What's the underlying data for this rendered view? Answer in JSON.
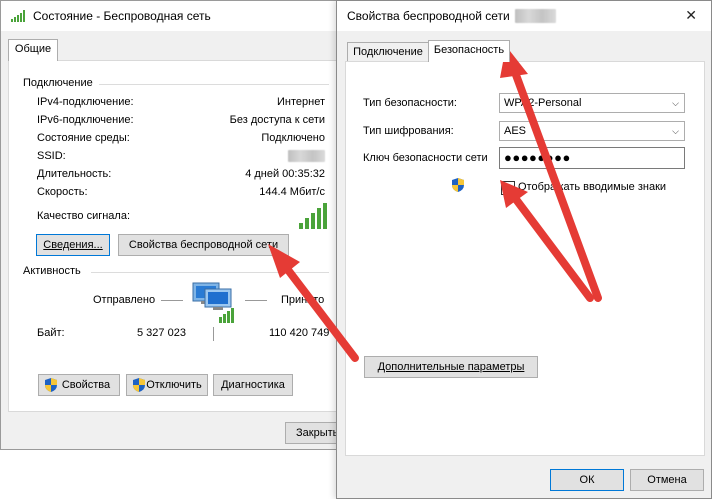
{
  "status_window": {
    "title": "Состояние - Беспроводная сеть",
    "close_glyph": "✕",
    "tab_general": "Общие",
    "section_connection": "Подключение",
    "rows": [
      {
        "label": "IPv4-подключение:",
        "value": "Интернет"
      },
      {
        "label": "IPv6-подключение:",
        "value": "Без доступа к сети"
      },
      {
        "label": "Состояние среды:",
        "value": "Подключено"
      },
      {
        "label": "SSID:",
        "value": "wifi_net"
      },
      {
        "label": "Длительность:",
        "value": "4 дней 00:35:32"
      },
      {
        "label": "Скорость:",
        "value": "144.4 Мбит/с"
      }
    ],
    "signal_quality_label": "Качество сигнала:",
    "details_button": "Сведения...",
    "wireless_props_button": "Свойства беспроводной сети",
    "section_activity": "Активность",
    "sent_label": "Отправлено",
    "received_label": "Принято",
    "bytes_label": "Байт:",
    "bytes_sent": "5 327 023",
    "bytes_received": "110 420 749",
    "properties_button": "Свойства",
    "disconnect_button": "Отключить",
    "diagnostics_button": "Диагностика",
    "close_button": "Закрыть"
  },
  "props_window": {
    "title": "Свойства беспроводной сети",
    "title_network": "wifi_net",
    "close_glyph": "✕",
    "tab_connection": "Подключение",
    "tab_security": "Безопасность",
    "security_type_label": "Тип безопасности:",
    "security_type_value": "WPA2-Personal",
    "encryption_type_label": "Тип шифрования:",
    "encryption_type_value": "AES",
    "key_label": "Ключ безопасности сети",
    "key_value": "●●●●●●●●",
    "show_chars_label": "Отображать вводимые знаки",
    "show_chars_checked": false,
    "advanced_button": "Дополнительные параметры",
    "ok_button": "ОК",
    "cancel_button": "Отмена"
  },
  "colors": {
    "accent": "#0078d7",
    "signal_green": "#4aa33a",
    "arrow_red": "#e53b35"
  }
}
